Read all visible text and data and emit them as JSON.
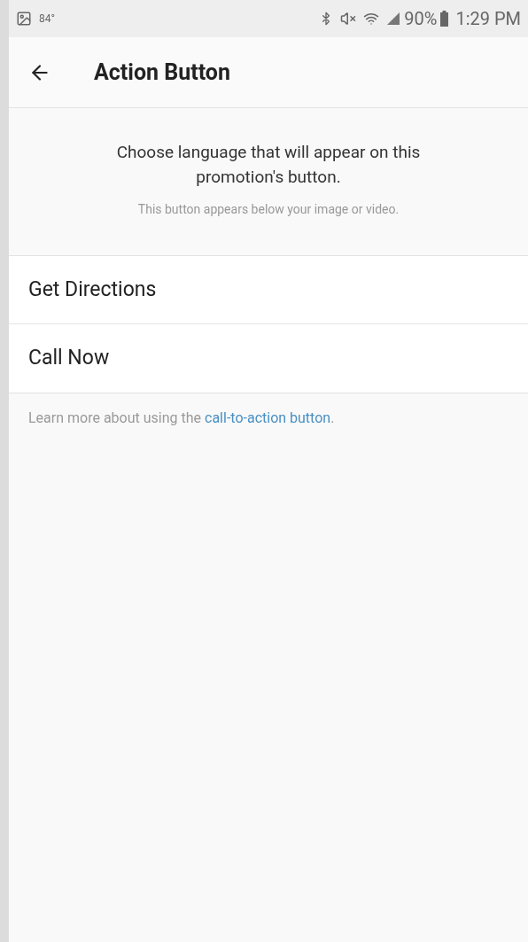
{
  "status_bar": {
    "temperature": "84°",
    "battery": "90%",
    "time": "1:29 PM"
  },
  "header": {
    "title": "Action Button"
  },
  "intro": {
    "heading": "Choose language that will appear on this promotion's button.",
    "note": "This button appears below your image or video."
  },
  "options": [
    {
      "label": "Get Directions"
    },
    {
      "label": "Call Now"
    }
  ],
  "footer": {
    "text": "Learn more about using the ",
    "link": "call-to-action button",
    "after": "."
  }
}
